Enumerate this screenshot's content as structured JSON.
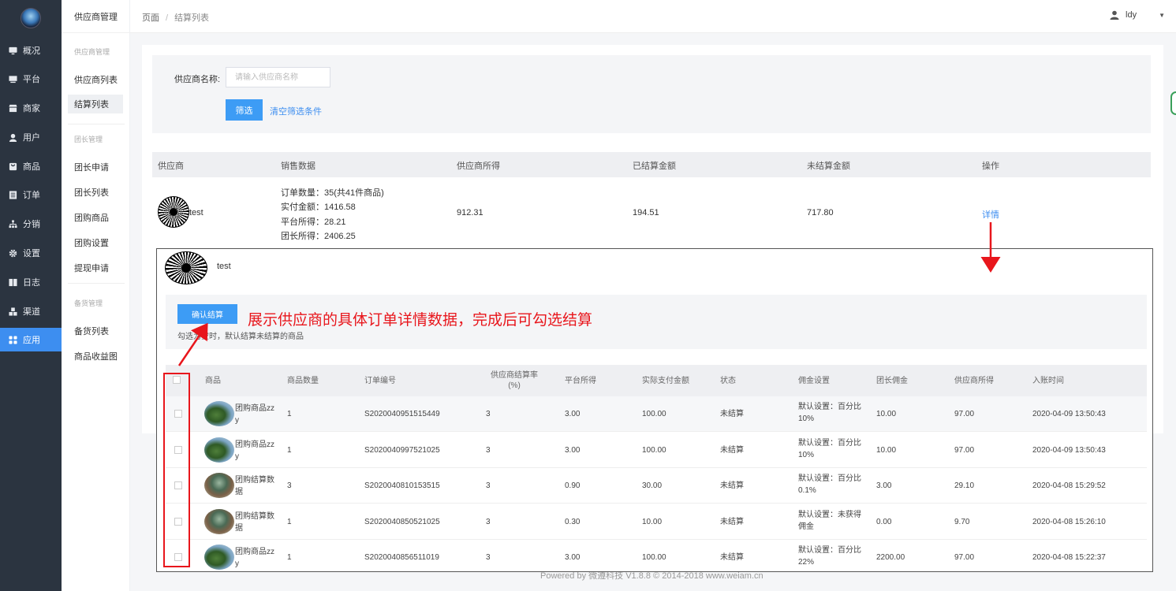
{
  "nav": {
    "items": [
      {
        "label": "概况",
        "icon": "monitor-icon"
      },
      {
        "label": "平台",
        "icon": "desktop-icon"
      },
      {
        "label": "商家",
        "icon": "store-icon"
      },
      {
        "label": "用户",
        "icon": "user-icon"
      },
      {
        "label": "商品",
        "icon": "bag-icon"
      },
      {
        "label": "订单",
        "icon": "list-icon"
      },
      {
        "label": "分销",
        "icon": "sitemap-icon"
      },
      {
        "label": "设置",
        "icon": "gear-icon"
      },
      {
        "label": "日志",
        "icon": "book-icon"
      },
      {
        "label": "渠道",
        "icon": "cubes-icon"
      },
      {
        "label": "应用",
        "icon": "apps-icon"
      }
    ],
    "active_index": 10
  },
  "subnav": {
    "title": "供应商管理",
    "groups": [
      {
        "title": "供应商管理",
        "items": [
          "供应商列表",
          "结算列表"
        ]
      },
      {
        "title": "团长管理",
        "items": [
          "团长申请",
          "团长列表",
          "团购商品",
          "团购设置",
          "提现申请"
        ]
      },
      {
        "title": "备货管理",
        "items": [
          "备货列表",
          "商品收益图"
        ]
      }
    ],
    "active_item": "结算列表"
  },
  "header": {
    "breadcrumb": [
      "页面",
      "结算列表"
    ],
    "user_name": "ldy"
  },
  "filter": {
    "label": "供应商名称:",
    "placeholder": "请输入供应商名称",
    "value": "",
    "submit_label": "筛选",
    "clear_label": "清空筛选条件"
  },
  "settlement_table": {
    "headers": [
      "供应商",
      "销售数据",
      "供应商所得",
      "已结算金额",
      "未结算金额",
      "操作"
    ],
    "row": {
      "supplier": "test",
      "sales": [
        "订单数量：35(共41件商品)",
        "实付金额：1416.58",
        "平台所得：28.21",
        "团长所得：2406.25"
      ],
      "supplier_income": "912.31",
      "settled": "194.51",
      "unsettled": "717.80",
      "action": "详情"
    }
  },
  "detail_panel": {
    "supplier": "test",
    "confirm_label": "确认结算",
    "hint": "勾选为空时，默认结算未结算的商品",
    "annotation": "展示供应商的具体订单详情数据，完成后可勾选结算",
    "headers": [
      "商品",
      "商品数量",
      "订单编号",
      "供应商结算率(%)",
      "平台所得",
      "实际支付金额",
      "状态",
      "佣金设置",
      "团长佣金",
      "供应商所得",
      "入账时间"
    ],
    "rows": [
      {
        "product": "团购商品zzy",
        "thumb": "green",
        "qty": "1",
        "order_no": "S2020040951515449",
        "rate": "3",
        "platform": "3.00",
        "paid": "100.00",
        "status": "未结算",
        "commission": "默认设置：百分比10%",
        "leader": "10.00",
        "supplier": "97.00",
        "time": "2020-04-09 13:50:43"
      },
      {
        "product": "团购商品zzy",
        "thumb": "green",
        "qty": "1",
        "order_no": "S2020040997521025",
        "rate": "3",
        "platform": "3.00",
        "paid": "100.00",
        "status": "未结算",
        "commission": "默认设置：百分比10%",
        "leader": "10.00",
        "supplier": "97.00",
        "time": "2020-04-09 13:50:43"
      },
      {
        "product": "团购结算数据",
        "thumb": "photo",
        "qty": "3",
        "order_no": "S2020040810153515",
        "rate": "3",
        "platform": "0.90",
        "paid": "30.00",
        "status": "未结算",
        "commission": "默认设置：百分比0.1%",
        "leader": "3.00",
        "supplier": "29.10",
        "time": "2020-04-08 15:29:52"
      },
      {
        "product": "团购结算数据",
        "thumb": "photo",
        "qty": "1",
        "order_no": "S2020040850521025",
        "rate": "3",
        "platform": "0.30",
        "paid": "10.00",
        "status": "未结算",
        "commission": "默认设置：未获得佣金",
        "leader": "0.00",
        "supplier": "9.70",
        "time": "2020-04-08 15:26:10"
      },
      {
        "product": "团购商品zzy",
        "thumb": "green",
        "qty": "1",
        "order_no": "S2020040856511019",
        "rate": "3",
        "platform": "3.00",
        "paid": "100.00",
        "status": "未结算",
        "commission": "默认设置：百分比22%",
        "leader": "2200.00",
        "supplier": "97.00",
        "time": "2020-04-08 15:22:37"
      }
    ]
  },
  "footer": "Powered by 微遵科技 V1.8.8 © 2014-2018 www.weiam.cn",
  "colors": {
    "sidebar": "#2b3440",
    "accent": "#3d8ef0",
    "annotation": "#e8161c"
  }
}
